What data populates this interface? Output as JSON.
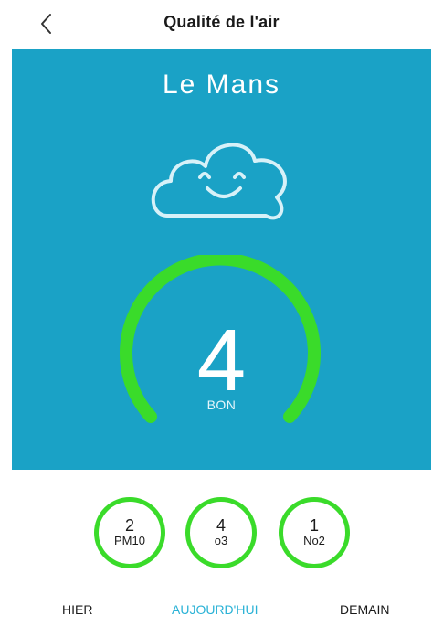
{
  "header": {
    "title": "Qualité de l'air"
  },
  "colors": {
    "panel": "#1aa2c6",
    "gauge": "#3adb2a",
    "active_tab": "#2ab2d6",
    "cloud_stroke": "#d7f1f8"
  },
  "icons": {
    "back": "chevron-left-icon",
    "cloud": "smiling-cloud-icon"
  },
  "main": {
    "city": "Le Mans",
    "aqi_value": "4",
    "aqi_label": "BON"
  },
  "pollutants": [
    {
      "value": "2",
      "name": "PM10"
    },
    {
      "value": "4",
      "name": "o3"
    },
    {
      "value": "1",
      "name": "No2"
    }
  ],
  "tabs": [
    {
      "label": "HIER",
      "active": false
    },
    {
      "label": "AUJOURD'HUI",
      "active": true
    },
    {
      "label": "DEMAIN",
      "active": false
    }
  ]
}
